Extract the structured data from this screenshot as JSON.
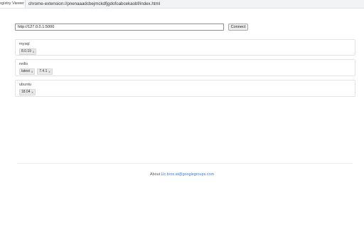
{
  "browser": {
    "tab_title": "egistry Viewer",
    "address": "chrome-extension://pnenaaadcbejmckdfjgdofoabcekaobf/index.html"
  },
  "connect": {
    "url_value": "http://127.0.0.1:5000",
    "button_label": "Connect"
  },
  "repositories": [
    {
      "name": "mysql",
      "tags": [
        {
          "label": "8.0.19",
          "remove": "x"
        }
      ]
    },
    {
      "name": "redis",
      "tags": [
        {
          "label": "latest",
          "remove": "x"
        },
        {
          "label": "7.4.1",
          "remove": "x"
        }
      ]
    },
    {
      "name": "ubuntu",
      "tags": [
        {
          "label": "18.04",
          "remove": "x"
        }
      ]
    }
  ],
  "footer": {
    "about_label": "About",
    "author_link": "Uc.bros.at@googlegroups.com"
  }
}
